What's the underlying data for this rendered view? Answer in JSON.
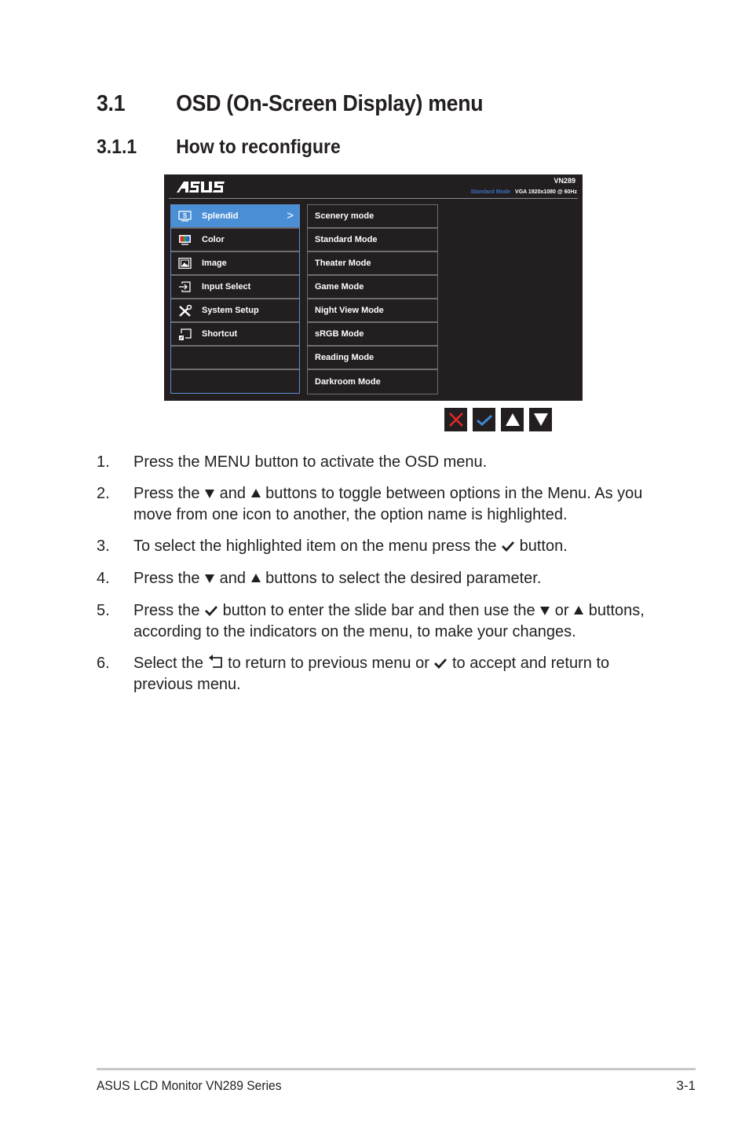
{
  "heading": {
    "number": "3.1",
    "title": "OSD (On-Screen Display) menu"
  },
  "subheading": {
    "number": "3.1.1",
    "title": "How to reconfigure"
  },
  "osd": {
    "logo": "/ISUS",
    "model": "VN289",
    "current_mode": "Standard Mode",
    "signal": "VGA  1920x1080 @ 60Hz",
    "accent_color": "#4a8fd6",
    "main_menu": [
      {
        "label": "Splendid",
        "icon": "splendid-icon",
        "active": true
      },
      {
        "label": "Color",
        "icon": "color-icon",
        "active": false
      },
      {
        "label": "Image",
        "icon": "image-icon",
        "active": false
      },
      {
        "label": "Input Select",
        "icon": "input-select-icon",
        "active": false
      },
      {
        "label": "System Setup",
        "icon": "system-setup-icon",
        "active": false
      },
      {
        "label": "Shortcut",
        "icon": "shortcut-icon",
        "active": false
      },
      {
        "label": "",
        "icon": "",
        "active": false
      },
      {
        "label": "",
        "icon": "",
        "active": false
      }
    ],
    "sub_menu": [
      "Scenery mode",
      "Standard Mode",
      "Theater Mode",
      "Game Mode",
      "Night View Mode",
      "sRGB Mode",
      "Reading Mode",
      "Darkroom Mode"
    ],
    "keys": [
      {
        "name": "close",
        "color": "#e0282e"
      },
      {
        "name": "check",
        "color": "#3d86d4"
      },
      {
        "name": "up",
        "color": "#ffffff"
      },
      {
        "name": "down",
        "color": "#ffffff"
      }
    ]
  },
  "steps": [
    {
      "n": "1.",
      "parts": [
        "Press the MENU button to activate the OSD menu."
      ]
    },
    {
      "n": "2.",
      "parts": [
        "Press the ",
        "{down}",
        " and ",
        "{up}",
        " buttons to toggle between options in the Menu. As you move from one icon to another, the option name is highlighted."
      ]
    },
    {
      "n": "3.",
      "parts": [
        "To select the highlighted item on the menu press the ",
        "{check}",
        " button."
      ]
    },
    {
      "n": "4.",
      "parts": [
        "Press the ",
        "{down}",
        " and ",
        "{up}",
        " buttons to select the desired parameter."
      ]
    },
    {
      "n": "5.",
      "parts": [
        "Press the ",
        "{check}",
        " button to enter the slide bar and then use the ",
        "{down}",
        " or ",
        "{up}",
        " buttons, according to the indicators on the menu, to make your changes."
      ]
    },
    {
      "n": "6.",
      "parts": [
        "Select the ",
        "{return}",
        " to return to previous menu or ",
        "{check}",
        " to accept and return to previous menu."
      ]
    }
  ],
  "footer": {
    "left": "ASUS LCD Monitor VN289 Series",
    "right": "3-1"
  }
}
